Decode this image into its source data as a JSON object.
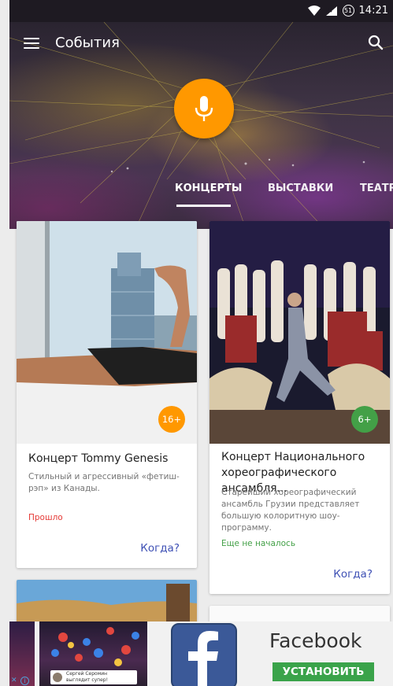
{
  "status_bar": {
    "time": "14:21",
    "battery_level": "51"
  },
  "app_bar": {
    "title": "События",
    "menu_icon": "menu-icon",
    "search_icon": "search-icon"
  },
  "hero": {
    "mic_icon": "microphone-icon",
    "accent": "#ff9800"
  },
  "tabs": [
    {
      "label": "КОНЦЕРТЫ",
      "active": true
    },
    {
      "label": "ВЫСТАВКИ",
      "active": false
    },
    {
      "label": "ТЕАТРЫ",
      "active": false
    }
  ],
  "cards": [
    {
      "title": "Концерт Tommy Genesis",
      "description": "Стильный и агрессивный «фетиш-рэп» из Канады.",
      "status": "Прошло",
      "status_color": "#e53935",
      "age": "16+",
      "age_color": "#ff9800",
      "when_label": "Когда?"
    },
    {
      "title": "Концерт Национального хореографического ансамбля...",
      "description": "Старейший хореографический ансамбль Грузии представляет большую колоритную шоу-программу.",
      "status": "Еще не началось",
      "status_color": "#43a047",
      "age": "6+",
      "age_color": "#43a047",
      "when_label": "Когда?"
    }
  ],
  "ad": {
    "close": "✕",
    "info": "i",
    "caption_name": "Сергей Серомин",
    "caption_text": "выглядит супер!",
    "brand": "Facebook",
    "install_label": "УСТАНОВИТЬ",
    "install_color": "#3aa34a"
  }
}
